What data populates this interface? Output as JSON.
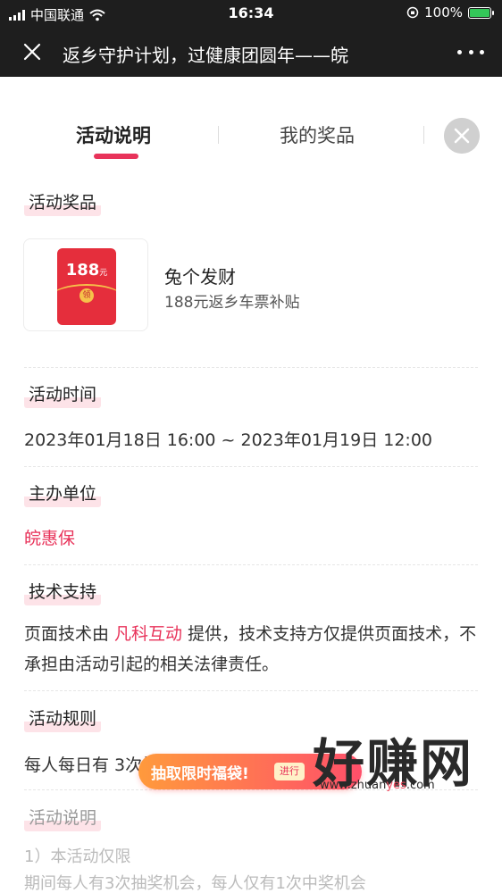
{
  "status_bar": {
    "carrier": "中国联通",
    "time": "16:34",
    "battery": "100%",
    "battery_level": 1.0
  },
  "nav": {
    "title": "返乡守护计划，过健康团圆年——皖"
  },
  "tabs": [
    {
      "label": "活动说明",
      "active": true
    },
    {
      "label": "我的奖品",
      "active": false
    }
  ],
  "sections": {
    "prizes": {
      "title": "活动奖品",
      "item": {
        "envelope_amount": "188",
        "envelope_unit": "元",
        "envelope_coin": "领",
        "name": "兔个发财",
        "desc": "188元返乡车票补贴"
      }
    },
    "time": {
      "title": "活动时间",
      "value": "2023年01月18日 16:00 ~ 2023年01月19日 12:00"
    },
    "organizer": {
      "title": "主办单位",
      "value": "皖惠保"
    },
    "tech": {
      "title": "技术支持",
      "before": "页面技术由 ",
      "link": "凡科互动",
      "after": " 提供，技术支持方仅提供页面技术，不承担由活动引起的相关法律责任。"
    },
    "rules": {
      "title": "活动规则",
      "value": "每人每日有 3次抽奖机会。"
    },
    "description": {
      "title": "活动说明",
      "line1": "1）本活动仅限",
      "line2": "期间每人有3次抽奖机会，每人仅有1次中奖机会"
    }
  },
  "promo": {
    "label": "抽取限时福袋!",
    "badge": "进行"
  },
  "watermark": {
    "big": "好赚网",
    "url_a": "www.zhuan",
    "url_b": "yes",
    "url_c": ".com"
  }
}
